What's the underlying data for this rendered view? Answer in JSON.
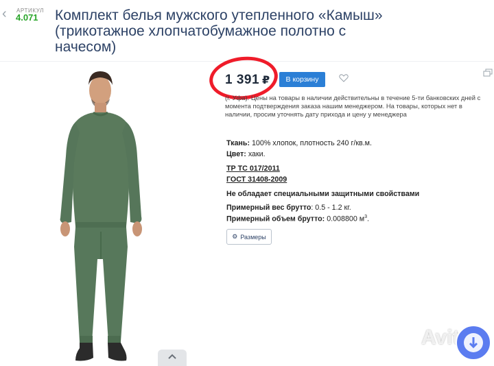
{
  "header": {
    "article_label": "АРТИКУЛ",
    "article_value": "4.071",
    "title": "Комплект белья мужского утепленного «Камыш» (трикотажное хлопчатобумажное полотно с начесом)"
  },
  "purchase": {
    "price": "1 391",
    "currency": "₽",
    "cart_label": "В корзину"
  },
  "availability": {
    "prefix": "(г. Уфа).",
    "text": "Цены на товары в наличии действительны в течение 5-ти банковских дней с момента подтверждения заказа нашим менеджером. На товары, которых нет в наличии, просим уточнять дату прихода и цену у менеджера"
  },
  "specs": {
    "fabric_label": "Ткань:",
    "fabric_value": "100% хлопок, плотность 240 г/кв.м.",
    "color_label": "Цвет:",
    "color_value": "хаки.",
    "standard_1": "ТР ТС 017/2011",
    "standard_2": "ГОСТ 31408-2009",
    "protection": "Не обладает специальными защитными свойствами",
    "weight_label": "Примерный вес брутто",
    "weight_value": ": 0.5 - 1.2 кг.",
    "volume_label": "Примерный объем брутто:",
    "volume_value": "0.008800 м",
    "volume_unit_sup": "3",
    "volume_end": "."
  },
  "sizes_button": "Размеры",
  "watermark": "Avito",
  "colors": {
    "accent": "#2b7fd6",
    "title": "#2d4266",
    "article": "#2aa52a",
    "highlight_circle": "#ef1c2a",
    "garment": "#5a7a5c"
  },
  "icons": [
    "chevron-left-icon",
    "heart-icon",
    "compare-icon",
    "gear-icon",
    "chevron-up-icon",
    "avito-badge-icon"
  ]
}
